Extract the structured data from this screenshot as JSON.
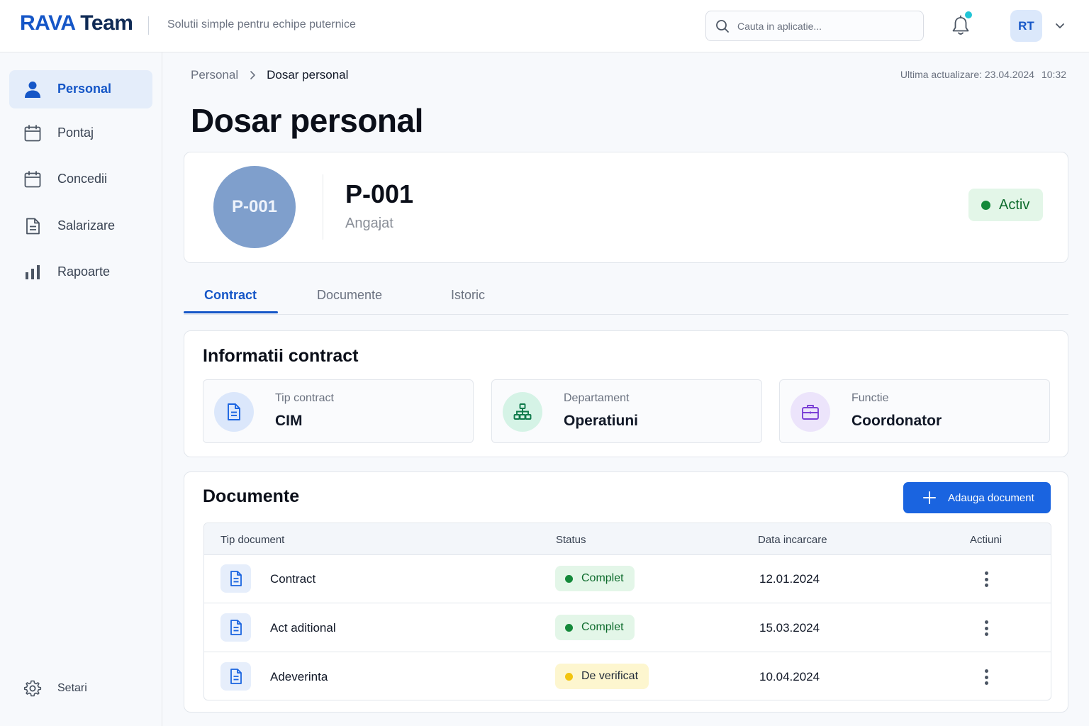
{
  "header": {
    "brand": "RAVA",
    "brand_suffix": " Team",
    "tagline": "Solutii simple pentru echipe puternice",
    "search_placeholder": "Cauta in aplicatie...",
    "user_initials": "RT"
  },
  "sidebar": {
    "items": [
      {
        "label": "Personal",
        "icon": "user-icon",
        "active": true
      },
      {
        "label": "Pontaj",
        "icon": "calendar-icon"
      },
      {
        "label": "Concedii",
        "icon": "calendar-icon"
      },
      {
        "label": "Salarizare",
        "icon": "document-icon"
      },
      {
        "label": "Rapoarte",
        "icon": "bar-chart-icon"
      }
    ],
    "settings_label": "Setari"
  },
  "breadcrumb": {
    "parent": "Personal",
    "current": "Dosar personal"
  },
  "last_update": {
    "label": "Ultima actualizare: 23.04.2024",
    "time": "10:32"
  },
  "page_title": "Dosar personal",
  "profile": {
    "avatar_text": "P-001",
    "id": "P-001",
    "role": "Angajat",
    "status": "Activ"
  },
  "tabs": [
    {
      "label": "Contract",
      "active": true
    },
    {
      "label": "Documente"
    },
    {
      "label": "Istoric"
    }
  ],
  "contract": {
    "title": "Informatii contract",
    "items": [
      {
        "label": "Tip contract",
        "value": "CIM",
        "icon": "document-icon",
        "color": "#dbe7fb"
      },
      {
        "label": "Departament",
        "value": "Operatiuni",
        "icon": "org-chart-icon",
        "color": "#d5f3e6"
      },
      {
        "label": "Functie",
        "value": "Coordonator",
        "icon": "briefcase-icon",
        "color": "#ece4fb"
      }
    ]
  },
  "documents": {
    "title": "Documente",
    "add_button": "Adauga document",
    "columns": [
      "Tip document",
      "Status",
      "Data incarcare",
      "Actiuni"
    ],
    "rows": [
      {
        "name": "Contract",
        "status": "Complet",
        "status_type": "ok",
        "date": "12.01.2024"
      },
      {
        "name": "Act aditional",
        "status": "Complet",
        "status_type": "ok",
        "date": "15.03.2024"
      },
      {
        "name": "Adeverinta",
        "status": "De verificat",
        "status_type": "warn",
        "date": "10.04.2024"
      }
    ]
  },
  "colors": {
    "accent": "#1556c7",
    "success": "#14893a",
    "warning": "#f2c40f"
  }
}
